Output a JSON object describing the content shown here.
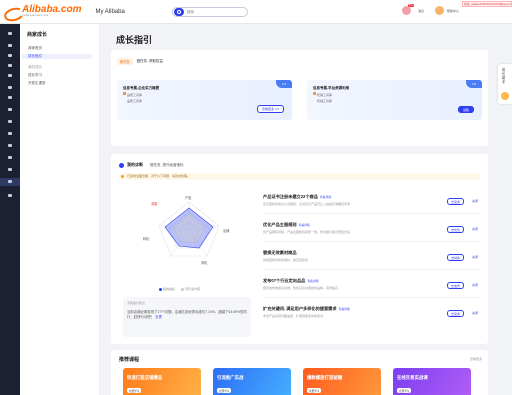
{
  "brand": {
    "logo_text": "Alibaba.com",
    "logo_sub": "Global trade starts here",
    "accent": "#ff6a00",
    "primary": "#2e3ef0"
  },
  "header": {
    "my_alibaba": "My Alibaba",
    "search_placeholder": "搜索",
    "msg_count": "99+",
    "welcome_text": "欢迎, gallamdr001920291418@qq.com",
    "notice_text": "消息",
    "notice_extra": "帮助中心"
  },
  "sidebar": {
    "title": "商家成长",
    "items": [
      "商家首页",
      "成长指引",
      "我的成长",
      "成长学习",
      "开放生课堂"
    ]
  },
  "page": {
    "title": "成长指引"
  },
  "task_card": {
    "tag": "新任务",
    "tab": "做任务, 获取权益",
    "tasks": [
      {
        "title": "信息专属-企业实力概要",
        "line1": "品质工具库",
        "line2": "品质工具库",
        "badge": "1/4",
        "button": "查看更多 1/4"
      },
      {
        "title": "信息专属-平台资源利用",
        "line1": "旺铺工具库",
        "line2": "旺铺工具库",
        "badge": "1/8",
        "button": "领取"
      }
    ]
  },
  "diagnosis": {
    "title": "我的诊断",
    "subtitle": "做任务, 提升经营指标",
    "warning": "已完成全面诊断，对于以下问题，请及时处理。",
    "radar_labels": {
      "top": "产品",
      "left_top": "流量",
      "left": "转化",
      "right": "店铺",
      "bottom": "商机"
    },
    "legend": [
      "我的指标",
      "同行业均值"
    ],
    "note_label": "专属提升建议",
    "note_text": "当前店铺近期发现了27个问题，店铺达到优秀标准仅7.24%，超越了63.69%的同行，赶快行动吧！",
    "note_link": "去提",
    "suggestions": [
      {
        "title": "产品证书注册未建立22个商品",
        "badge": "查看详情",
        "desc": "完善更新的信息认证规则，证书完善产品可让入驻提高准确完善率",
        "button": "去完成",
        "link": "关闭"
      },
      {
        "title": "优化产品主图规则",
        "badge": "查看详情",
        "desc": "优产品拥有视频、产品主图规则完整一致，优化图片展示更加合适",
        "button": "去优化",
        "link": "关闭"
      },
      {
        "title": "替换无效素材商品",
        "badge": "",
        "desc": "替换更新有效的素材，提高完整性",
        "button": "去替换",
        "link": "关闭"
      },
      {
        "title": "发布07个行业定向品品",
        "badge": "查看详情",
        "desc": "规范发布的相关领域，优化完善并更新的品种，有效提高",
        "button": "去发布",
        "link": "关闭"
      },
      {
        "title": "扩充关键词, 满足用户多样化的搜索需求",
        "badge": "查看详情",
        "desc": "丰富产品关键词覆盖量，扩展到更多的搜索词",
        "button": "去完成",
        "link": "关闭"
      }
    ]
  },
  "courses": {
    "title": "推荐课程",
    "more": "查看更多",
    "items": [
      {
        "title": "快速打造店铺爆品",
        "chip": "免费学习",
        "name": "快速打造店铺爆品",
        "color1": "#ff7a1a",
        "color2": "#ffb347"
      },
      {
        "title": "引流推广实战",
        "chip": "立即学习",
        "name": "引流推广实战",
        "color1": "#2f6df6",
        "color2": "#44b0ff"
      },
      {
        "title": "爆款螺旋打造秘籍",
        "chip": "免费学习",
        "name": "通过爆款螺旋思路系统解析",
        "color1": "#ff5a1f",
        "color2": "#ff9a3c"
      },
      {
        "title": "在线交易实战课",
        "chip": "立即学习",
        "name": "在线交易实战课",
        "color1": "#7b3ff2",
        "color2": "#b25ef5"
      }
    ]
  },
  "right_float": {
    "text": "成长助手",
    "avatar": "avatar"
  }
}
